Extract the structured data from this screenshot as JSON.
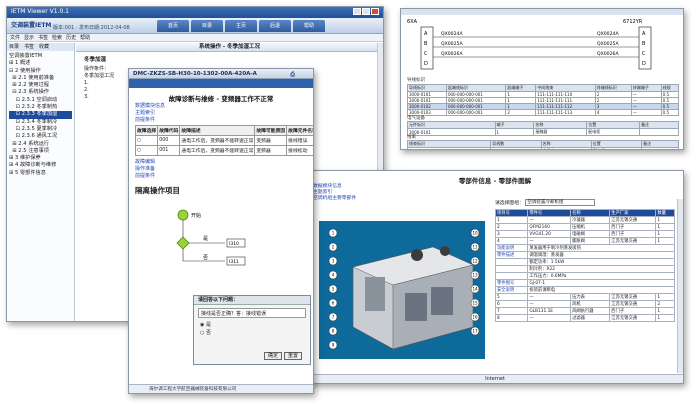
{
  "w1": {
    "title": "IETM Viewer V1.0.1",
    "logo": "交调装置IETM",
    "version": "版本:001 · 发布日期:2012-04-08",
    "tabs": [
      "首页",
      "目录",
      "主页",
      "后退",
      "帮助"
    ],
    "menu": [
      "文件",
      "显示",
      "书签",
      "检索",
      "历史",
      "帮助"
    ],
    "side_tabs": [
      "目录",
      "书签",
      "收藏"
    ],
    "tree": [
      "空调装置IETM",
      "⊞ 1 概述",
      "⊟ 2 使用操作",
      "  ⊞ 2.1 使用前准备",
      "  ⊞ 2.2 使用过程",
      "  ⊟ 2.3 系统操作",
      "    ⊡ 2.3.1 空调启动",
      "    ⊡ 2.3.2 冬季制热",
      "    ⊡ 2.3.3 冬季加湿",
      "    ⊡ 2.3.4 冬季制冷",
      "    ⊡ 2.3.5 夏季制冷",
      "    ⊡ 2.3.6 通风工况",
      "  ⊞ 2.4 系统运行",
      "  ⊞ 2.5 注意事项",
      "⊞ 3 维护保养",
      "⊞ 4 故障诊断与维修",
      "⊞ 5 零部件信息"
    ],
    "tree_selected_index": 8,
    "main_bar": "系统操作 - 冬季加湿工况",
    "main_sub": "冬季加湿",
    "main_lines": [
      "操作条件：",
      "冬季加湿工况",
      "1.",
      "2.",
      "3."
    ]
  },
  "w2": {
    "code_top": "6XA",
    "code_right": "6712YR",
    "left_letters": [
      "A",
      "B",
      "C",
      "D"
    ],
    "right_letters": [
      "A",
      "B",
      "C",
      "D"
    ],
    "wire_labels": [
      "QX0024A",
      "QX0025A",
      "QX0026A"
    ],
    "wire_labels_r": [
      "QX0024A",
      "QX0025A",
      "QX0026A"
    ],
    "section1": "导线标识",
    "table1_header": [
      "导线标识",
      "起端线标识",
      "起端端子",
      "中间线束",
      "终端线标识",
      "终端端子",
      "线规"
    ],
    "table1_rows": [
      [
        "3000-0101",
        "000-000-000-001",
        "1",
        "111-111-111-110",
        "2",
        "—",
        "0.5"
      ],
      [
        "3000-0101",
        "000-000-000-001",
        "1",
        "111-111-111-111",
        "2",
        "—",
        "0.5"
      ],
      [
        "3000-0102",
        "000-000-000-001",
        "1",
        "111-111-111-112",
        "3",
        "—",
        "0.5"
      ],
      [
        "3000-0103",
        "000-000-000-001",
        "2",
        "111-111-111-113",
        "4",
        "—",
        "0.5"
      ]
    ],
    "selected_row": 2,
    "section2": "电气设备",
    "table2_header": [
      "元件标识",
      "端子",
      "名称",
      "位置",
      "备注"
    ],
    "table2_rows": [
      [
        "3000-0101",
        "1",
        "接触器",
        "配电柜",
        ""
      ]
    ],
    "section3": "线束",
    "table3_header": [
      "线束标识",
      "导线数",
      "名称",
      "位置",
      "备注"
    ],
    "table3_rows": [
      [
        "3000-0001",
        "4",
        "主线束",
        "配电柜",
        ""
      ]
    ]
  },
  "w3": {
    "window_title": "DMC-ZKZS-SB-H30-10-1302-00A-420A-A",
    "page_title": "故障诊断与维修 - 变频器工作不正常",
    "links": [
      "数据模块信息",
      "主题索引",
      "前提条件"
    ],
    "fault_header": [
      "故障选择",
      "故障代码",
      "故障描述",
      "故障可能原因",
      "故障元件名称",
      "故障元件处理"
    ],
    "fault_rows": [
      [
        "○",
        "000",
        "通电工作后，变频器不能转速正常",
        "变频器",
        "接线错误"
      ],
      [
        "○",
        "001",
        "通电工作后，变频器不能转速正常",
        "变频器",
        "接线松动"
      ]
    ],
    "links2": [
      "故障编辑",
      "操作准备",
      "前提条件"
    ],
    "section": "隔离操作项目",
    "flow_start": "开始",
    "flow_yes": "是",
    "flow_no": "否",
    "flow_box1": "I310",
    "flow_box2": "I311",
    "dialog_title": "请回答以下问题：",
    "dialog_question": "接线是否正确？答：接线错误",
    "dialog_options": [
      "是",
      "否"
    ],
    "dialog_ok": "确定",
    "dialog_reset": "重置",
    "status": "海尔调工程大学航空器械装备科技有限公司"
  },
  "w4": {
    "page_title": "零部件信息 - 零部件图解",
    "links": [
      "数据模块信息",
      "主题索引",
      "空调机组主要零部件"
    ],
    "select_label": "请选择图组：",
    "select_value": "空调装置冷却机组",
    "parts_header": [
      "项目号",
      "零件号",
      "名称",
      "生产厂家",
      "数量"
    ],
    "parts_rows": [
      [
        "1",
        "—",
        "冷凝器",
        "江苏无锡交通",
        "1"
      ],
      [
        "2",
        "QFM2160",
        "压缩机",
        "西门子",
        "1"
      ],
      [
        "3",
        "VVG41.20",
        "电磁阀",
        "西门子",
        "1"
      ],
      [
        "4",
        "—",
        "膨胀阀",
        "江苏无锡交通",
        "1"
      ]
    ],
    "detail": [
      [
        "功能说明",
        "蒸发器用于制冷剂蒸发吸热"
      ],
      [
        "零件描述",
        "调温调湿：蒸发器"
      ],
      [
        "",
        "额定功率：1.5kW"
      ],
      [
        "",
        "制冷剂：R22"
      ],
      [
        "",
        "工作压力：0.6MPa"
      ],
      [
        "零件图号",
        "GJ-07-1"
      ],
      [
        "安全说明",
        "拆装前请断电"
      ]
    ],
    "parts_rows2": [
      [
        "5",
        "—",
        "压力表",
        "江苏无锡交通",
        "1"
      ],
      [
        "6",
        "—",
        "风机",
        "江苏无锡交通",
        "2"
      ],
      [
        "7",
        "GLB131.1E",
        "风阀执行器",
        "西门子",
        "1"
      ],
      [
        "8",
        "—",
        "过滤器",
        "江苏无锡交通",
        "1"
      ]
    ],
    "callouts": [
      "1",
      "2",
      "3",
      "4",
      "5",
      "6",
      "7",
      "8",
      "9",
      "10",
      "11",
      "12",
      "13",
      "14",
      "15",
      "16",
      "17"
    ],
    "status": "Internet"
  }
}
